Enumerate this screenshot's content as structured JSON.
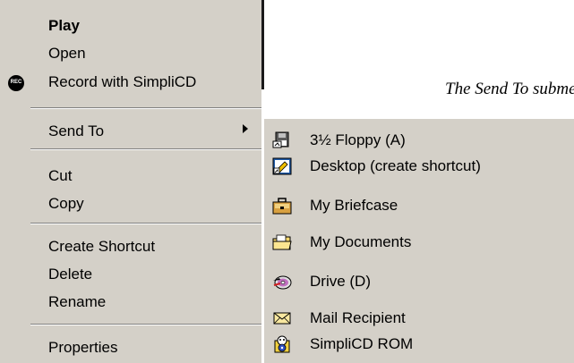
{
  "context_menu": {
    "items": [
      {
        "label": "Play",
        "bold": true
      },
      {
        "label": "Open"
      },
      {
        "label": "Record with SimpliCD"
      },
      {
        "label": "Send To",
        "has_submenu": true
      },
      {
        "label": "Cut"
      },
      {
        "label": "Copy"
      },
      {
        "label": "Create Shortcut"
      },
      {
        "label": "Delete"
      },
      {
        "label": "Rename"
      },
      {
        "label": "Properties"
      }
    ],
    "record_icon_text": "REC"
  },
  "caption": "The Send To submenu",
  "send_to_submenu": {
    "items": [
      {
        "label": "3½ Floppy (A)",
        "icon": "floppy-icon"
      },
      {
        "label": "Desktop (create shortcut)",
        "icon": "desktop-shortcut-icon"
      },
      {
        "label": "My Briefcase",
        "icon": "briefcase-icon"
      },
      {
        "label": "My Documents",
        "icon": "folder-icon"
      },
      {
        "label": "Drive (D)",
        "icon": "cd-drive-icon"
      },
      {
        "label": "Mail Recipient",
        "icon": "envelope-icon"
      },
      {
        "label": "SimpliCD ROM",
        "icon": "simplicd-icon"
      }
    ]
  },
  "colors": {
    "menu_bg": "#d4d0c8",
    "separator_dark": "#808080",
    "separator_light": "#ffffff"
  }
}
